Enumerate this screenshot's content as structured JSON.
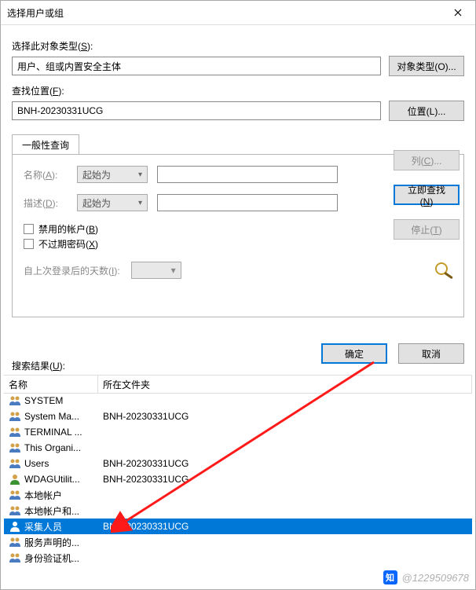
{
  "title": "选择用户或组",
  "section1": {
    "label_prefix": "选择此对象类型(",
    "label_key": "S",
    "label_suffix": "):",
    "value": "用户、组或内置安全主体",
    "button": "对象类型(O)..."
  },
  "section2": {
    "label_prefix": "查找位置(",
    "label_key": "F",
    "label_suffix": "):",
    "value": "BNH-20230331UCG",
    "button": "位置(L)..."
  },
  "tab": {
    "label": "一般性查询"
  },
  "query": {
    "name_label_prefix": "名称(",
    "name_label_key": "A",
    "name_label_suffix": "):",
    "desc_label_prefix": "描述(",
    "desc_label_key": "D",
    "desc_label_suffix": "):",
    "combo_value": "起始为",
    "chk_disabled_prefix": "禁用的帐户(",
    "chk_disabled_key": "B",
    "chk_disabled_suffix": ")",
    "chk_noexpire_prefix": "不过期密码(",
    "chk_noexpire_key": "X",
    "chk_noexpire_suffix": ")",
    "days_label_prefix": "自上次登录后的天数(",
    "days_label_key": "I",
    "days_label_suffix": "):"
  },
  "side_buttons": {
    "columns": "列(C)...",
    "find_now": "立即查找(N)",
    "stop": "停止(T)"
  },
  "actions": {
    "ok": "确定",
    "cancel": "取消"
  },
  "results_label_prefix": "搜索结果(",
  "results_label_key": "U",
  "results_label_suffix": "):",
  "columns": {
    "name": "名称",
    "folder": "所在文件夹"
  },
  "rows": [
    {
      "icon": "group",
      "name": "SYSTEM",
      "folder": ""
    },
    {
      "icon": "group",
      "name": "System Ma...",
      "folder": "BNH-20230331UCG"
    },
    {
      "icon": "group",
      "name": "TERMINAL ...",
      "folder": ""
    },
    {
      "icon": "group",
      "name": "This Organi...",
      "folder": ""
    },
    {
      "icon": "group",
      "name": "Users",
      "folder": "BNH-20230331UCG"
    },
    {
      "icon": "user",
      "name": "WDAGUtilit...",
      "folder": "BNH-20230331UCG"
    },
    {
      "icon": "group",
      "name": "本地帐户",
      "folder": ""
    },
    {
      "icon": "group",
      "name": "本地帐户和...",
      "folder": ""
    },
    {
      "icon": "user",
      "name": "采集人员",
      "folder": "BNH-20230331UCG",
      "selected": true
    },
    {
      "icon": "group",
      "name": "服务声明的...",
      "folder": ""
    },
    {
      "icon": "group",
      "name": "身份验证机...",
      "folder": ""
    }
  ],
  "watermark": {
    "logo": "知",
    "text": "@1229509678"
  }
}
